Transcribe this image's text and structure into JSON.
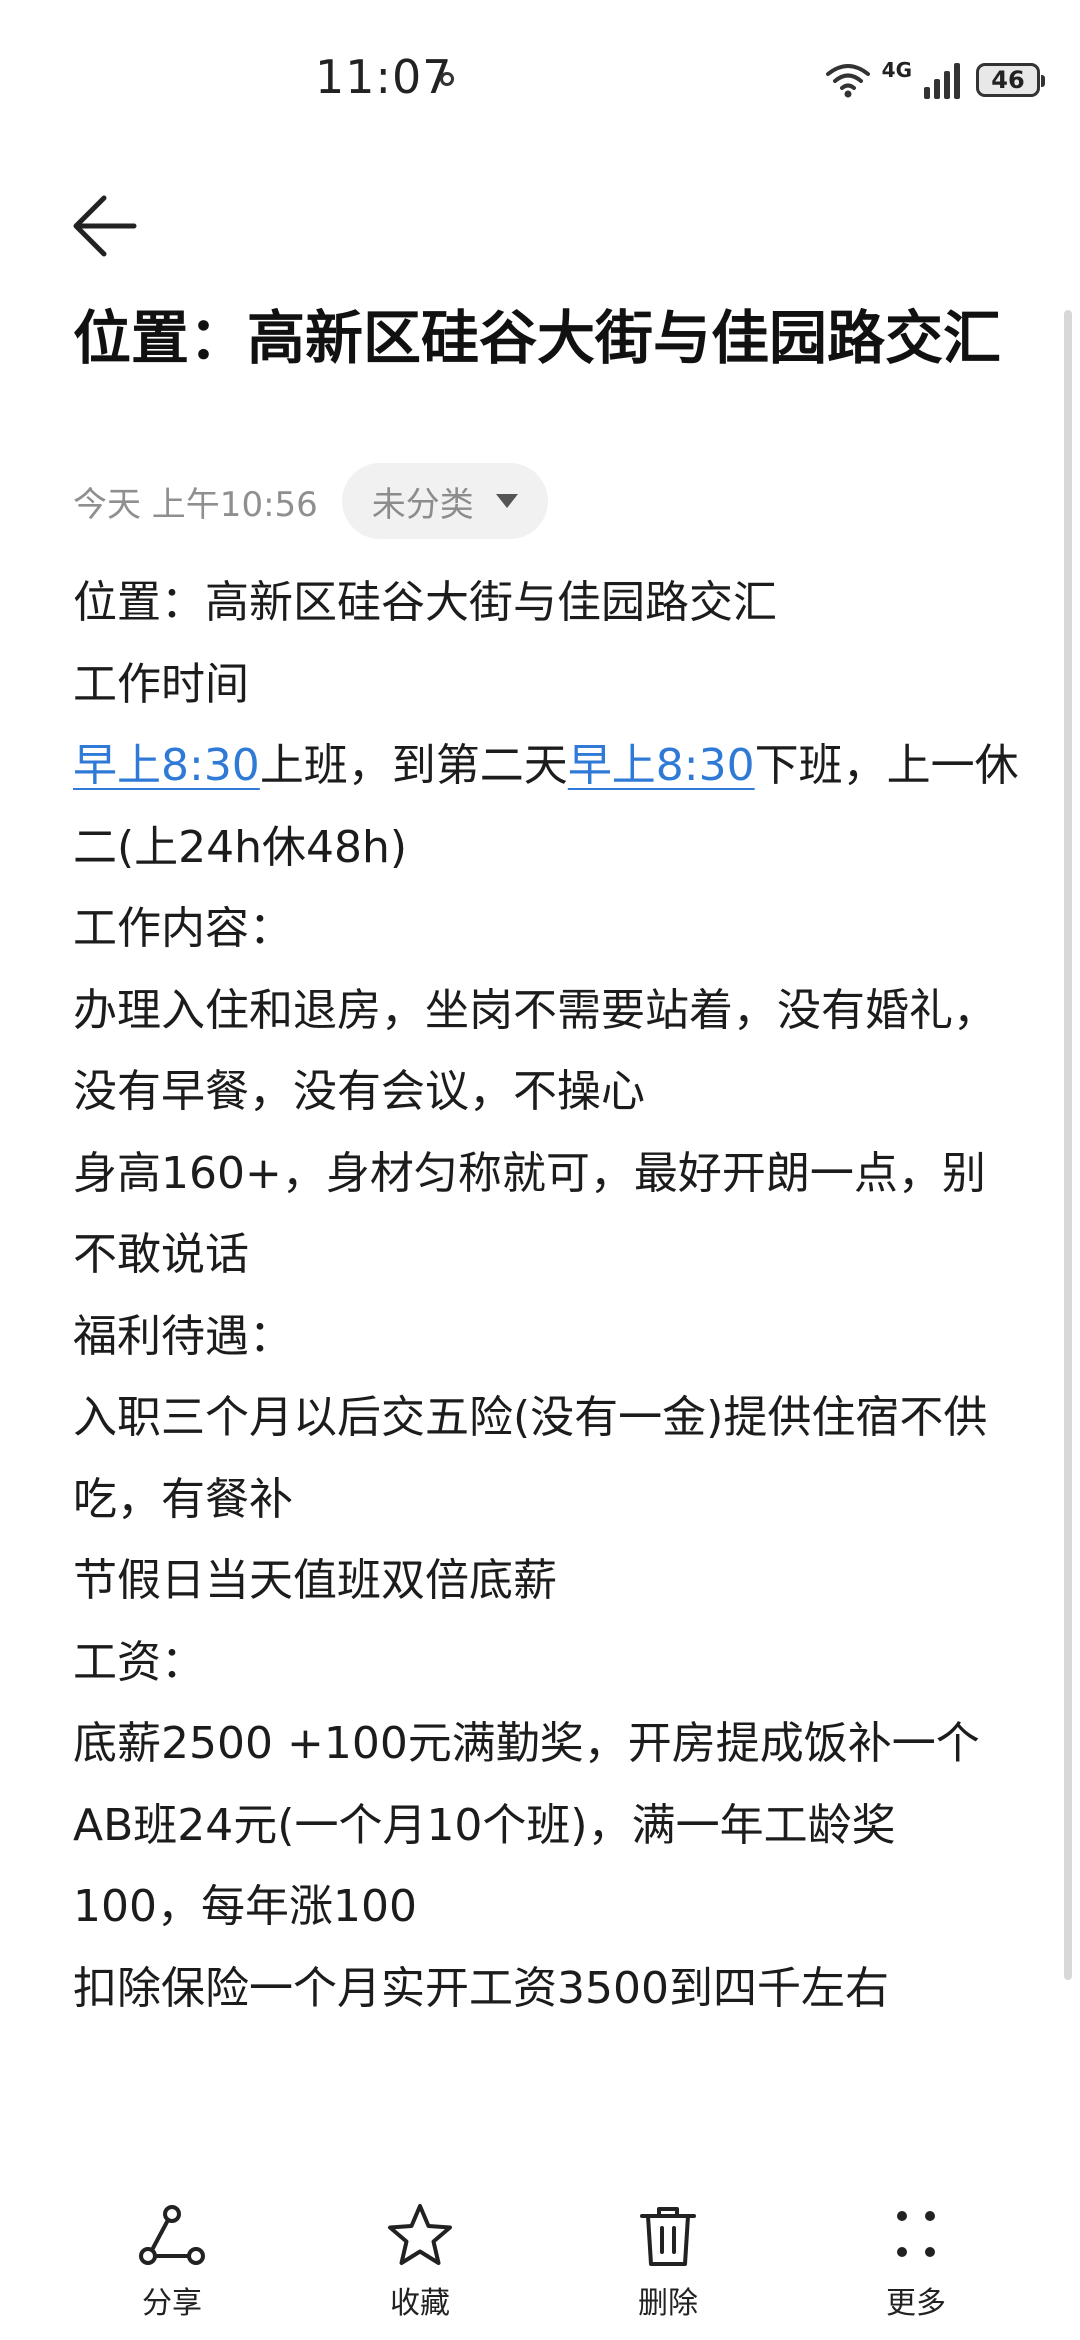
{
  "status_bar": {
    "time": "11:07",
    "network": "4G",
    "battery": "46"
  },
  "note": {
    "title": "位置：高新区硅谷大街与佳园路交汇",
    "date": "今天 上午10:56",
    "category": "未分类",
    "lines": {
      "l1": "位置：高新区硅谷大街与佳园路交汇",
      "l2": "工作时间",
      "l3_link1": "早上8:30",
      "l3_mid": "上班，到第二天",
      "l3_link2": "早上8:30",
      "l3_end": "下班，上一休二(上24h休48h)",
      "l4": "工作内容：",
      "l5": "办理入住和退房，坐岗不需要站着，没有婚礼，没有早餐，没有会议，不操心",
      "l6": "身高160+，身材匀称就可，最好开朗一点，别不敢说话",
      "l7": "福利待遇：",
      "l8": "入职三个月以后交五险(没有一金)提供住宿不供吃，有餐补",
      "l9": "节假日当天值班双倍底薪",
      "l10": "工资：",
      "l11": "底薪2500 +100元满勤奖，开房提成饭补一个AB班24元(一个月10个班)，满一年工龄奖100，每年涨100",
      "l12": "扣除保险一个月实开工资3500到四千左右"
    }
  },
  "toolbar": {
    "share": "分享",
    "favorite": "收藏",
    "delete": "删除",
    "more": "更多"
  }
}
